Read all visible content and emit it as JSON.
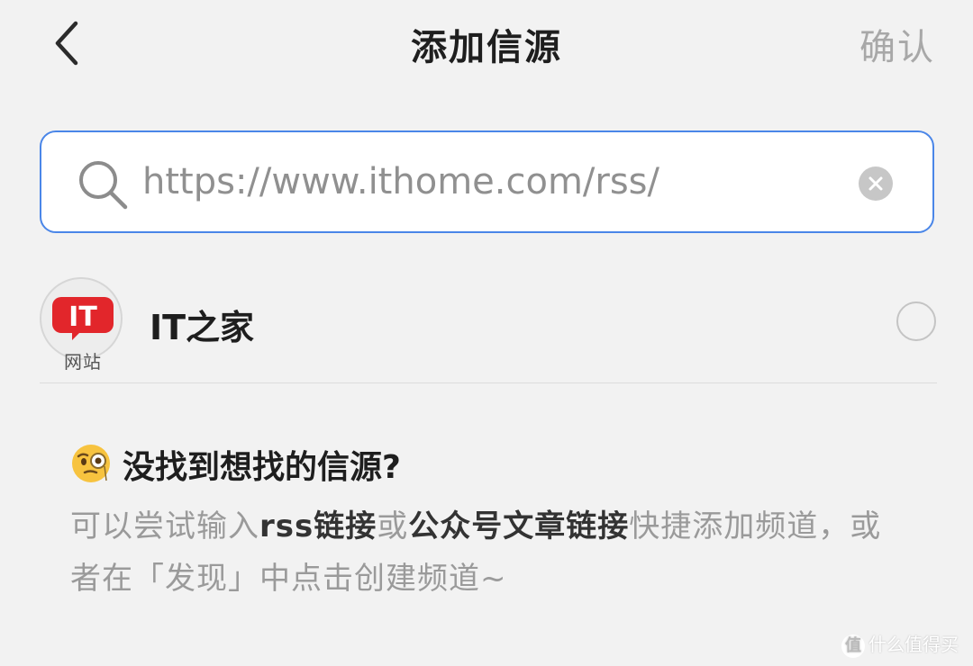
{
  "header": {
    "title": "添加信源",
    "confirm_label": "确认"
  },
  "search": {
    "value": "https://www.ithome.com/rss/",
    "placeholder": ""
  },
  "results": [
    {
      "logo_text": "IT",
      "logo_type": "网站",
      "name": "IT之家",
      "selected": false
    }
  ],
  "help": {
    "title": "没找到想找的信源?",
    "text_prefix": "可以尝试输入",
    "bold1": "rss链接",
    "text_mid": "或",
    "bold2": "公众号文章链接",
    "text_suffix": "快捷添加频道，或者在「发现」中点击创建频道~"
  },
  "watermark": {
    "text": "什么值得买",
    "icon_text": "值"
  },
  "colors": {
    "accent_border": "#4a86e8",
    "logo_red": "#e2262b",
    "background": "#f2f2f2"
  }
}
